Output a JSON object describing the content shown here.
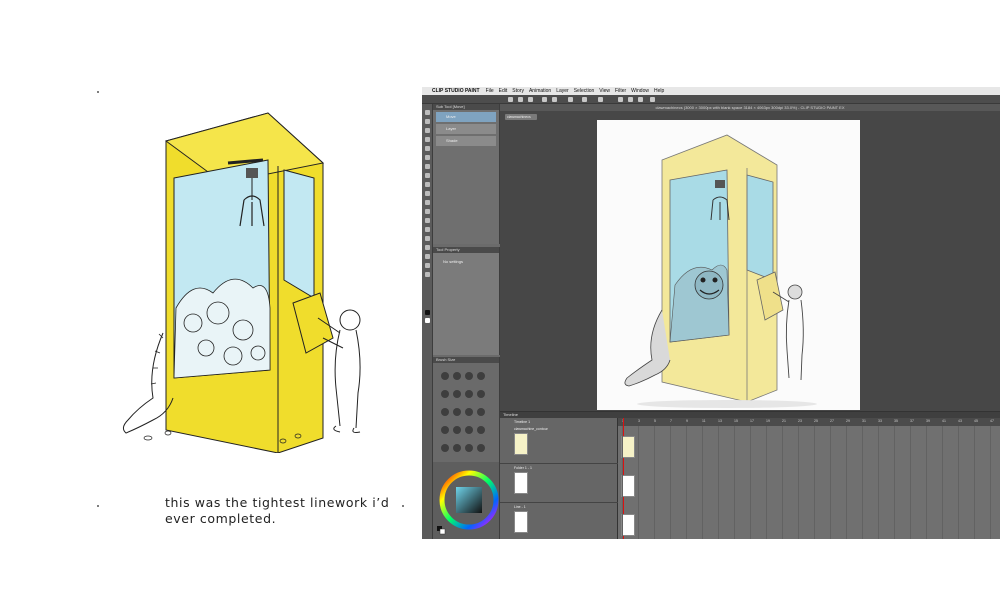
{
  "caption": {
    "line1": "this was the tightest linework i’d",
    "line2": "ever completed."
  },
  "app": {
    "menu": [
      "CLIP STUDIO PAINT",
      "File",
      "Edit",
      "Story",
      "Animation",
      "Layer",
      "Selection",
      "View",
      "Filter",
      "Window",
      "Help"
    ],
    "window_title": "clawmachinecs (3000 × 3000px with blank space 3184 × 4063px 300dpi 33.0%) - CLIP STUDIO PAINT EX",
    "sub_tool_header": "Sub Tool [Move]",
    "sub_tools": [
      "Move",
      "Layer",
      "Shade"
    ],
    "property_header": "Tool Property",
    "property_text": "No settings",
    "brush_header": "Brush Size",
    "canvas_tab": "clawmachinecs",
    "timeline_header": "Timeline",
    "timeline_name": "Timeline 1",
    "tracks": [
      "clawmachine_contour",
      "Folder 1 - 1",
      "Line - 1"
    ],
    "ruler": [
      "1",
      "3",
      "5",
      "7",
      "9",
      "11",
      "13",
      "15",
      "17",
      "19",
      "21",
      "23",
      "25",
      "27",
      "29",
      "31",
      "33",
      "35",
      "37",
      "39",
      "41",
      "43",
      "45",
      "47"
    ]
  },
  "colors": {
    "machine_yellow": "#f0dd2c",
    "glass_blue": "#bfe6f0",
    "ui_gray": "#6b6b6b"
  }
}
